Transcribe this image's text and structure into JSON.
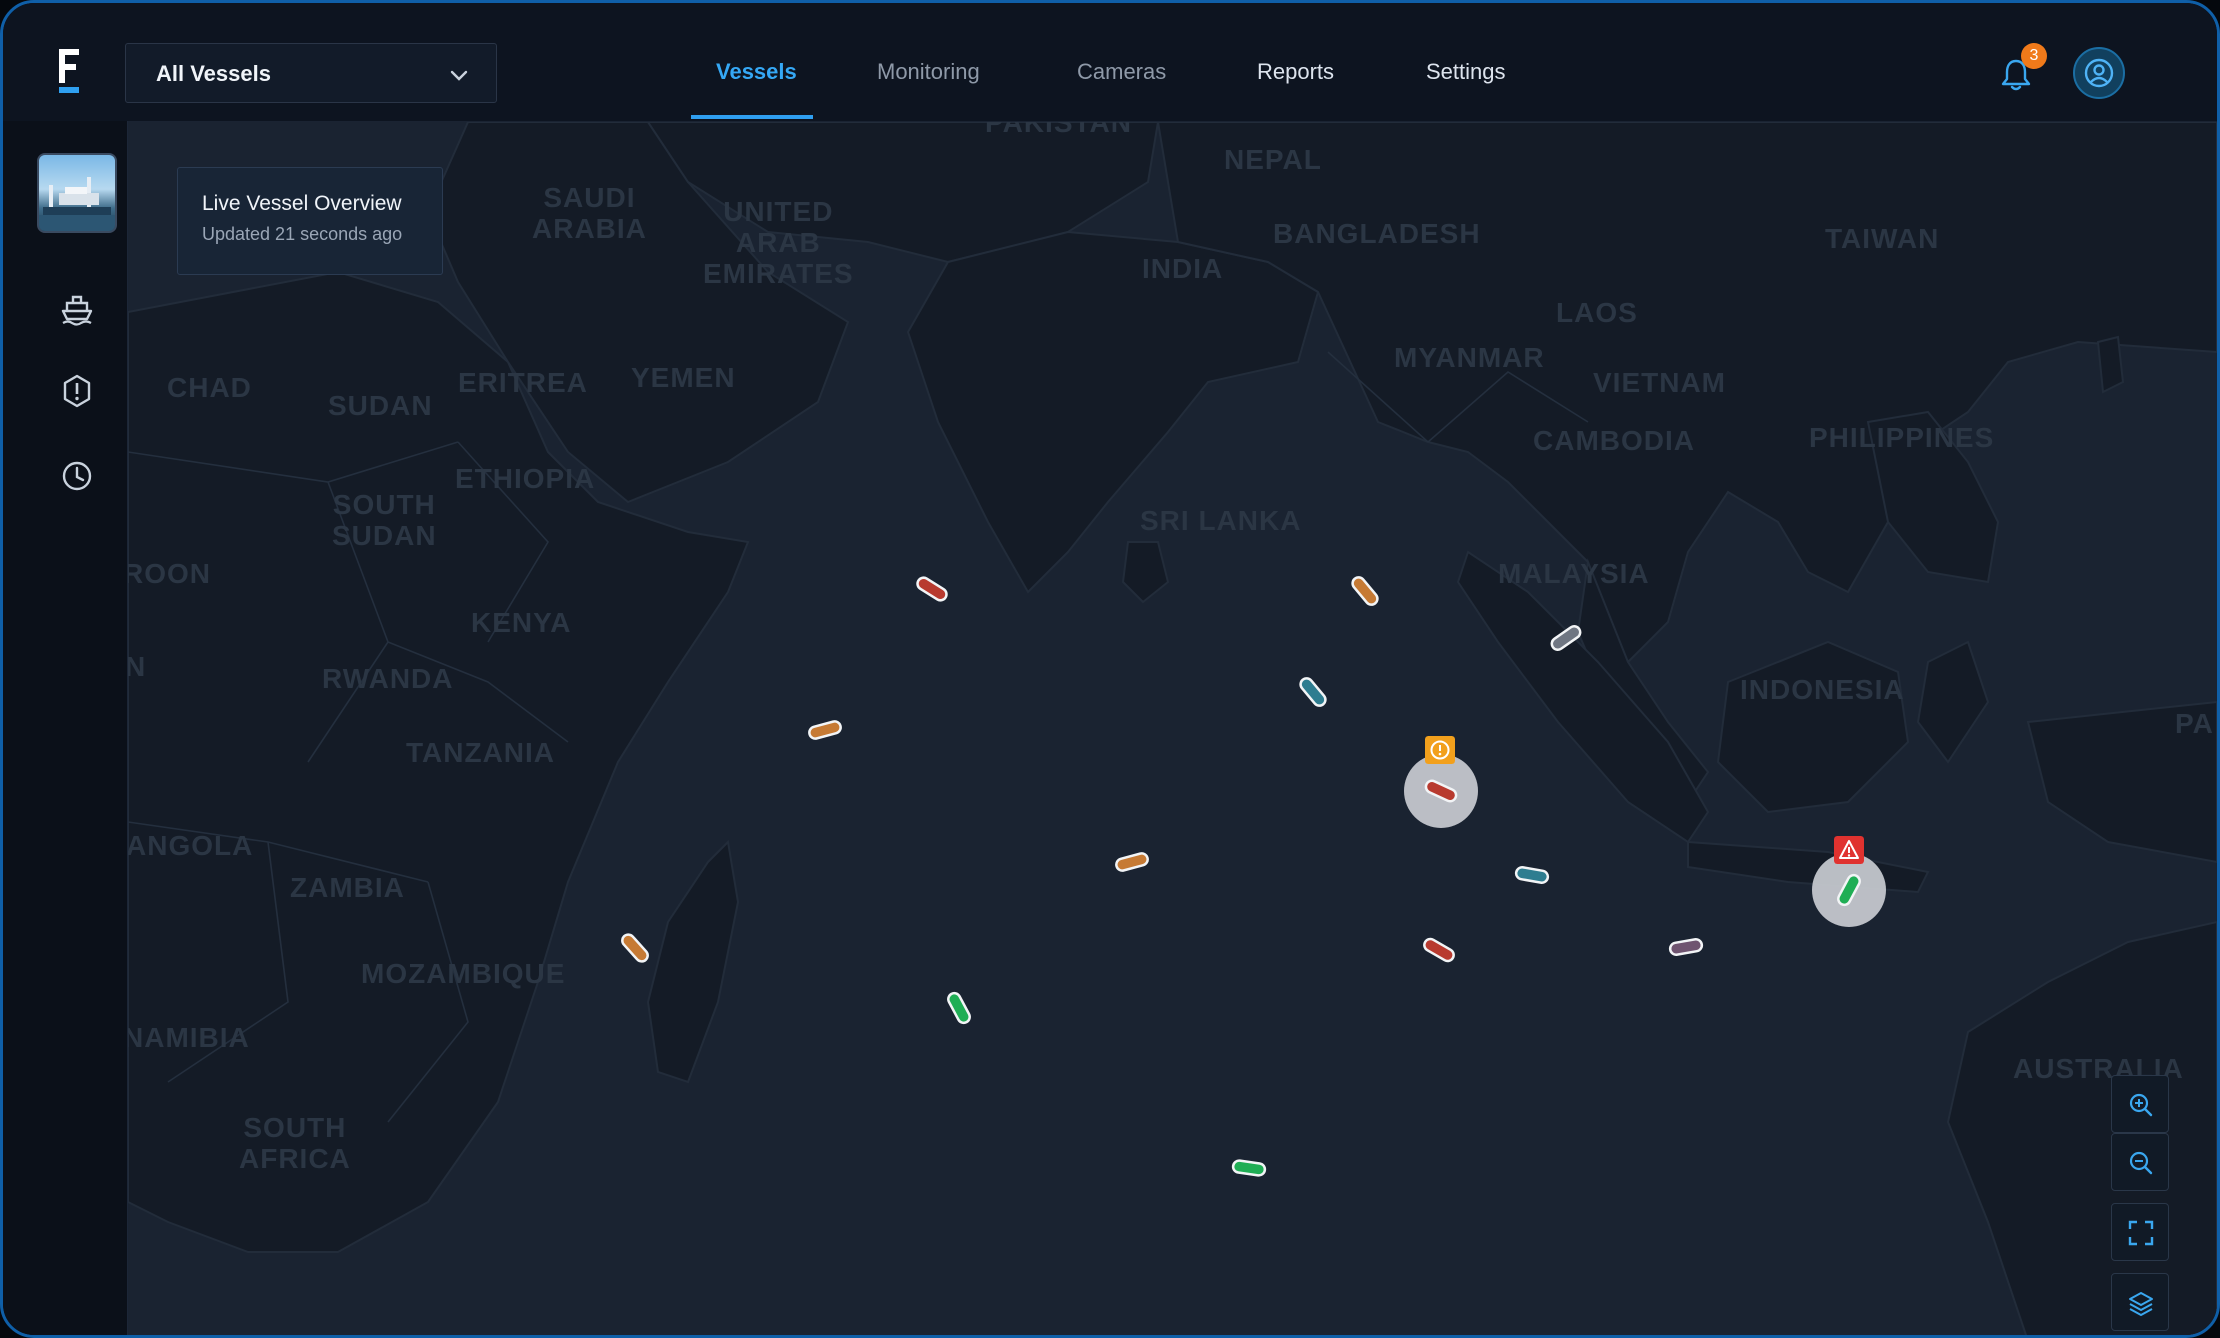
{
  "header": {
    "vessel_filter": {
      "selected": "All Vessels"
    },
    "tabs": [
      {
        "label": "Vessels",
        "active": true
      },
      {
        "label": "Monitoring",
        "active": false
      },
      {
        "label": "Cameras",
        "active": false
      },
      {
        "label": "Reports",
        "active": false
      },
      {
        "label": "Settings",
        "active": false
      }
    ],
    "notifications_count": "3",
    "icons": [
      "bell-icon",
      "user-icon",
      "chevron-down-icon"
    ]
  },
  "sidebar": {
    "items": [
      {
        "name": "vessel-thumbnail",
        "icon": "ship-photo"
      },
      {
        "name": "ship-icon"
      },
      {
        "name": "alert-octagon-icon"
      },
      {
        "name": "clock-icon"
      }
    ]
  },
  "overview": {
    "title": "Live Vessel Overview",
    "updated": "Updated 21 seconds ago"
  },
  "map": {
    "countries": {
      "pakistan": "PAKISTAN",
      "nepal": "NEPAL",
      "saudi_arabia": "SAUDI\nARABIA",
      "uae": "UNITED\nARAB\nEMIRATES",
      "bangladesh": "BANGLADESH",
      "india": "INDIA",
      "taiwan": "TAIWAN",
      "laos": "LAOS",
      "myanmar": "MYANMAR",
      "vietnam": "VIETNAM",
      "chad": "CHAD",
      "eritrea": "ERITREA",
      "yemen": "YEMEN",
      "sudan": "SUDAN",
      "cambodia": "CAMBODIA",
      "philippines": "PHILIPPINES",
      "ethiopia": "ETHIOPIA",
      "south_sudan": "SOUTH\nSUDAN",
      "sri_lanka": "SRI LANKA",
      "malaysia": "MALAYSIA",
      "roon": "ROON",
      "kenya": "KENYA",
      "rwanda": "RWANDA",
      "n": "N",
      "indonesia": "INDONESIA",
      "tanzania": "TANZANIA",
      "pa": "PA",
      "angola": "ANGOLA",
      "zambia": "ZAMBIA",
      "mozambique": "MOZAMBIQUE",
      "namibia": "NAMIBIA",
      "australia": "AUSTRALIA",
      "south_africa": "SOUTH\nAFRICA"
    },
    "colors": {
      "water": "#1a2331",
      "land": "#141b26",
      "border": "#222c3a",
      "vessel_red": "#b83a2f",
      "vessel_orange": "#c67a34",
      "vessel_green": "#1fae55",
      "vessel_teal": "#2e7d90",
      "vessel_grey": "#6f7682",
      "vessel_purple": "#6f5470",
      "warning": "#f2a01c",
      "danger": "#e0322f"
    },
    "vessels": [
      {
        "status": "red"
      },
      {
        "status": "orange"
      },
      {
        "status": "grey"
      },
      {
        "status": "teal"
      },
      {
        "status": "orange"
      },
      {
        "status": "red",
        "alert": "warning"
      },
      {
        "status": "orange"
      },
      {
        "status": "teal"
      },
      {
        "status": "green",
        "alert": "danger"
      },
      {
        "status": "orange"
      },
      {
        "status": "red"
      },
      {
        "status": "purple"
      },
      {
        "status": "green"
      },
      {
        "status": "green"
      }
    ],
    "controls": [
      "zoom-in-icon",
      "zoom-out-icon",
      "fullscreen-icon",
      "layers-icon"
    ]
  }
}
